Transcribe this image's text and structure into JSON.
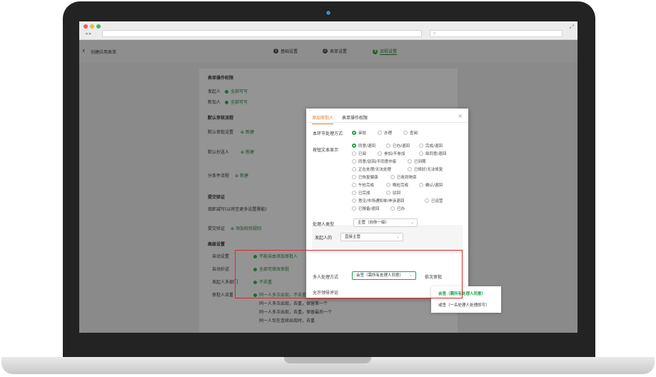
{
  "browser": {
    "search_icon": "search-icon",
    "back_forward": "◂ ▸",
    "expand_icon": "⤢"
  },
  "colors": {
    "accent_green": "#21a34a",
    "tab_orange": "#e07a2a",
    "highlight_red": "#d9272e"
  },
  "header": {
    "back_icon": "‹",
    "title": "创建应用表单",
    "steps": [
      {
        "num": "1",
        "label": "基础设置"
      },
      {
        "num": "2",
        "label": "表单设置"
      },
      {
        "num": "3",
        "label": "流程设置"
      }
    ]
  },
  "left": {
    "s1_title": "表单操作权限",
    "initiator_label": "发起人",
    "initiator_value": "全部可写",
    "newcomer_label": "新加人",
    "newcomer_value": "全部可写",
    "s2_title": "默认审核流程",
    "default_approver": "默认审批设置",
    "add1": "新建",
    "default_cc": "默认抄送人",
    "add2": "新建",
    "condition_flow": "分条件流程",
    "add3": "新建",
    "s3_title": "提交验证",
    "validate_row": "填即减写(以将至更多设置需能)",
    "submit_validate": "提交验证",
    "add_validate": "添加校验规则",
    "s4_title": "高级设置",
    "adv": [
      {
        "label": "自动设置",
        "value": "不能自由添加审批人"
      },
      {
        "label": "自动抄送",
        "value": "全部可修改审批"
      },
      {
        "label": "发起人多部门",
        "value": "不去重"
      },
      {
        "label": "审批人去重",
        "value": "同一人多次出现，不去重"
      }
    ],
    "adv_extra": "去重",
    "dedupe_more": [
      "同一人多次出现，去重，保留第一个",
      "同一人多次出现，去重，保留最后一个",
      "同一人仅在连续出现时，去重"
    ]
  },
  "modal": {
    "tabs": [
      "添加审批人",
      "表单操作权限"
    ],
    "close": "×",
    "method_label": "本环节处理方式",
    "methods": [
      "审批",
      "办理",
      "查阅"
    ],
    "button_label": "按钮文本显示",
    "buttons": [
      [
        "同意/退回",
        "已办/退回",
        "完成/退回"
      ],
      [
        "已阅",
        "参加/不参加",
        "拟同意/退回"
      ],
      [
        "同意/驳回/不同意作废",
        "已到期"
      ],
      [
        "正在处理/无法处理",
        "已修好/无法修复"
      ],
      [
        "已恢复健康",
        "已收到物资"
      ],
      [
        "午检完成",
        "晚检完成",
        "确认/退回"
      ],
      [
        "已完成",
        "驳回"
      ],
      [
        "意见/市场通知单/申诉退回",
        "已运营"
      ],
      [
        "已报备/退回",
        "已办"
      ]
    ],
    "handler_type_label": "处理人类型",
    "handler_type_value": "主管（向你一级）",
    "initiator_label": "发起人的",
    "initiator_value": "直接主管",
    "multi_label": "多人处理方式",
    "multi_value": "会签（需所有处理人同意）",
    "order_label": "依次审批",
    "sign_label": "允许领导评论",
    "dropdown": [
      {
        "label": "会签（需所有处理人同意）",
        "selected": true
      },
      {
        "label": "或签（一名处理人处理即可）",
        "selected": false
      }
    ]
  }
}
